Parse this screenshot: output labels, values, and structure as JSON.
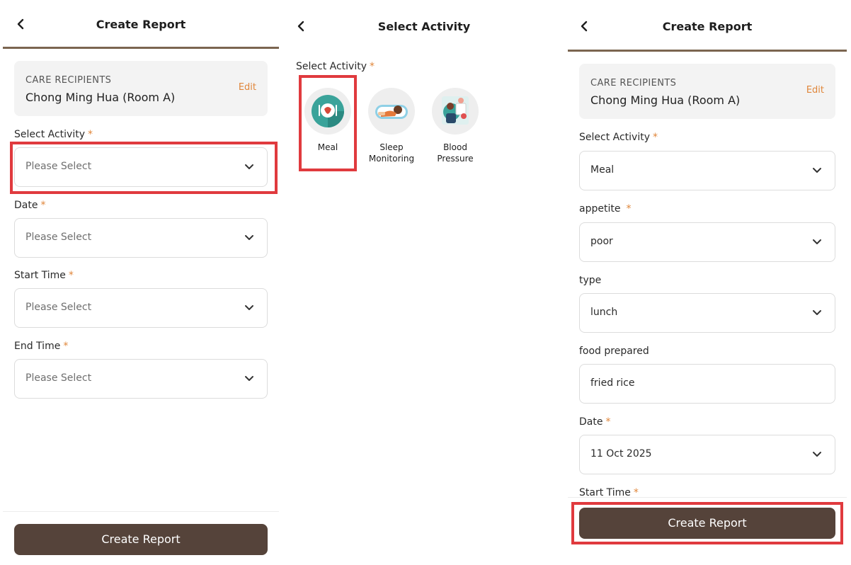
{
  "screen1": {
    "header": {
      "title": "Create Report"
    },
    "recipients": {
      "label": "CARE RECIPIENTS",
      "name": "Chong Ming Hua (Room A)",
      "edit": "Edit"
    },
    "fields": [
      {
        "label": "Select Activity",
        "required": "*",
        "value": "Please Select"
      },
      {
        "label": "Date",
        "required": "*",
        "value": "Please Select"
      },
      {
        "label": "Start Time",
        "required": "*",
        "value": "Please Select"
      },
      {
        "label": "End Time",
        "required": "*",
        "value": "Please Select"
      }
    ],
    "submit": "Create Report"
  },
  "screen2": {
    "header": {
      "title": "Select Activity"
    },
    "label": "Select Activity",
    "required": "*",
    "activities": [
      {
        "label": "Meal",
        "icon": "meal-icon"
      },
      {
        "label": "Sleep Monitoring",
        "icon": "sleep-icon"
      },
      {
        "label": "Blood Pressure",
        "icon": "blood-pressure-icon"
      }
    ]
  },
  "screen3": {
    "header": {
      "title": "Create Report"
    },
    "recipients": {
      "label": "CARE RECIPIENTS",
      "name": "Chong Ming Hua (Room A)",
      "edit": "Edit"
    },
    "fields": [
      {
        "label": "Select Activity",
        "required": "*",
        "value": "Meal"
      },
      {
        "label": "appetite",
        "required": "*",
        "value": "poor"
      },
      {
        "label": "type",
        "required": "",
        "value": "lunch"
      },
      {
        "label": "food prepared",
        "required": "",
        "value": "fried rice"
      },
      {
        "label": "Date",
        "required": "*",
        "value": "11 Oct 2025"
      }
    ],
    "cut_label": {
      "label": "Start Time",
      "required": "*"
    },
    "submit": "Create Report"
  },
  "colors": {
    "accent": "#e0863a",
    "brand_dark": "#55433a",
    "header_rule": "#7b6550",
    "highlight": "#e03a3e"
  }
}
